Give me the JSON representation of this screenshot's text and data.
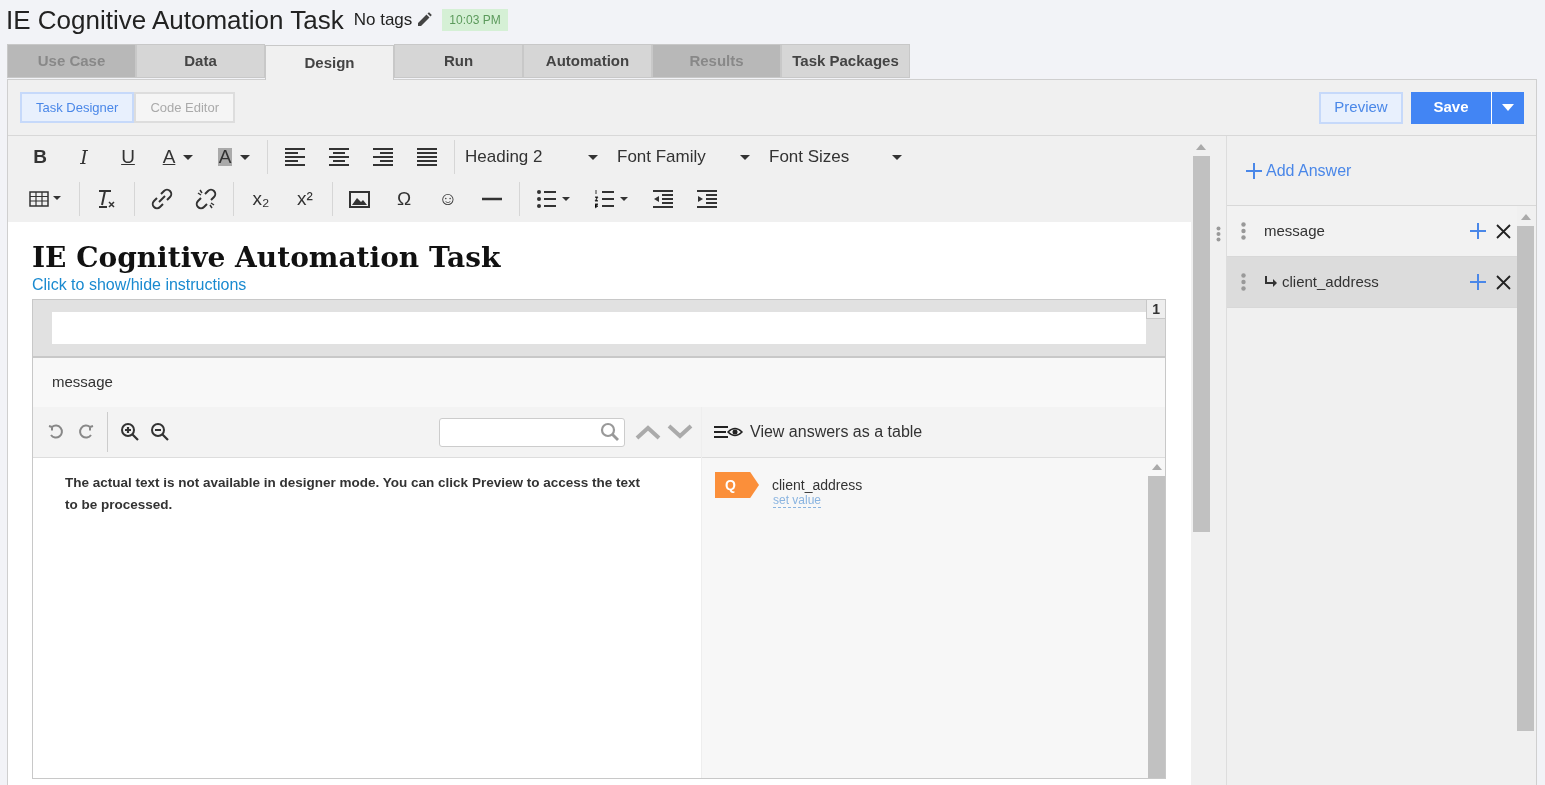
{
  "header": {
    "title": "IE Cognitive Automation Task",
    "tags": "No tags",
    "time": "10:03 PM"
  },
  "tabs": [
    {
      "label": "Use Case",
      "selected": false,
      "disabled": true
    },
    {
      "label": "Data",
      "selected": false,
      "disabled": false
    },
    {
      "label": "Design",
      "selected": true,
      "disabled": false
    },
    {
      "label": "Run",
      "selected": false,
      "disabled": false
    },
    {
      "label": "Automation",
      "selected": false,
      "disabled": false
    },
    {
      "label": "Results",
      "selected": false,
      "disabled": true
    },
    {
      "label": "Task Packages",
      "selected": false,
      "disabled": false
    }
  ],
  "modes": [
    {
      "label": "Task Designer",
      "selected": true
    },
    {
      "label": "Code Editor",
      "selected": false
    }
  ],
  "actions": {
    "preview": "Preview",
    "save": "Save"
  },
  "toolbar": {
    "rows": [
      [
        {
          "kind": "bold",
          "text": "B"
        },
        {
          "kind": "italic",
          "text": "I"
        },
        {
          "kind": "underline",
          "text": "U"
        },
        {
          "kind": "textcolor",
          "text": "A"
        },
        {
          "kind": "bgcolor",
          "text": "A"
        },
        {
          "kind": "sep"
        },
        {
          "kind": "align-left"
        },
        {
          "kind": "align-center"
        },
        {
          "kind": "align-right"
        },
        {
          "kind": "justify"
        },
        {
          "kind": "sep"
        },
        {
          "kind": "select",
          "text": "Heading 2"
        },
        {
          "kind": "select",
          "text": "Font Family"
        },
        {
          "kind": "select",
          "text": "Font Sizes"
        }
      ],
      [
        {
          "kind": "table"
        },
        {
          "kind": "sep"
        },
        {
          "kind": "clear-format"
        },
        {
          "kind": "sep"
        },
        {
          "kind": "link"
        },
        {
          "kind": "unlink"
        },
        {
          "kind": "sep"
        },
        {
          "kind": "glyph",
          "text": "x₂"
        },
        {
          "kind": "glyph",
          "text": "x²"
        },
        {
          "kind": "sep"
        },
        {
          "kind": "image"
        },
        {
          "kind": "glyph",
          "text": "Ω"
        },
        {
          "kind": "glyph",
          "text": "☺"
        },
        {
          "kind": "hr"
        },
        {
          "kind": "sep"
        },
        {
          "kind": "bullets"
        },
        {
          "kind": "numbers"
        },
        {
          "kind": "outdent"
        },
        {
          "kind": "indent"
        }
      ]
    ]
  },
  "document": {
    "heading": "IE Cognitive Automation Task",
    "instructions_link": "Click to show/hide instructions",
    "page_number": "1",
    "field_label": "message",
    "view_answers": "View answers as a table",
    "notice": "The actual text is not available in designer mode. You can click Preview to access the text to be processed.",
    "questions": [
      {
        "badge": "Q",
        "name": "client_address",
        "action": "set value"
      }
    ]
  },
  "answers": {
    "add_label": "Add Answer",
    "items": [
      {
        "name": "message",
        "selected": false,
        "children": [
          {
            "name": "client_address",
            "selected": true
          }
        ]
      }
    ]
  }
}
